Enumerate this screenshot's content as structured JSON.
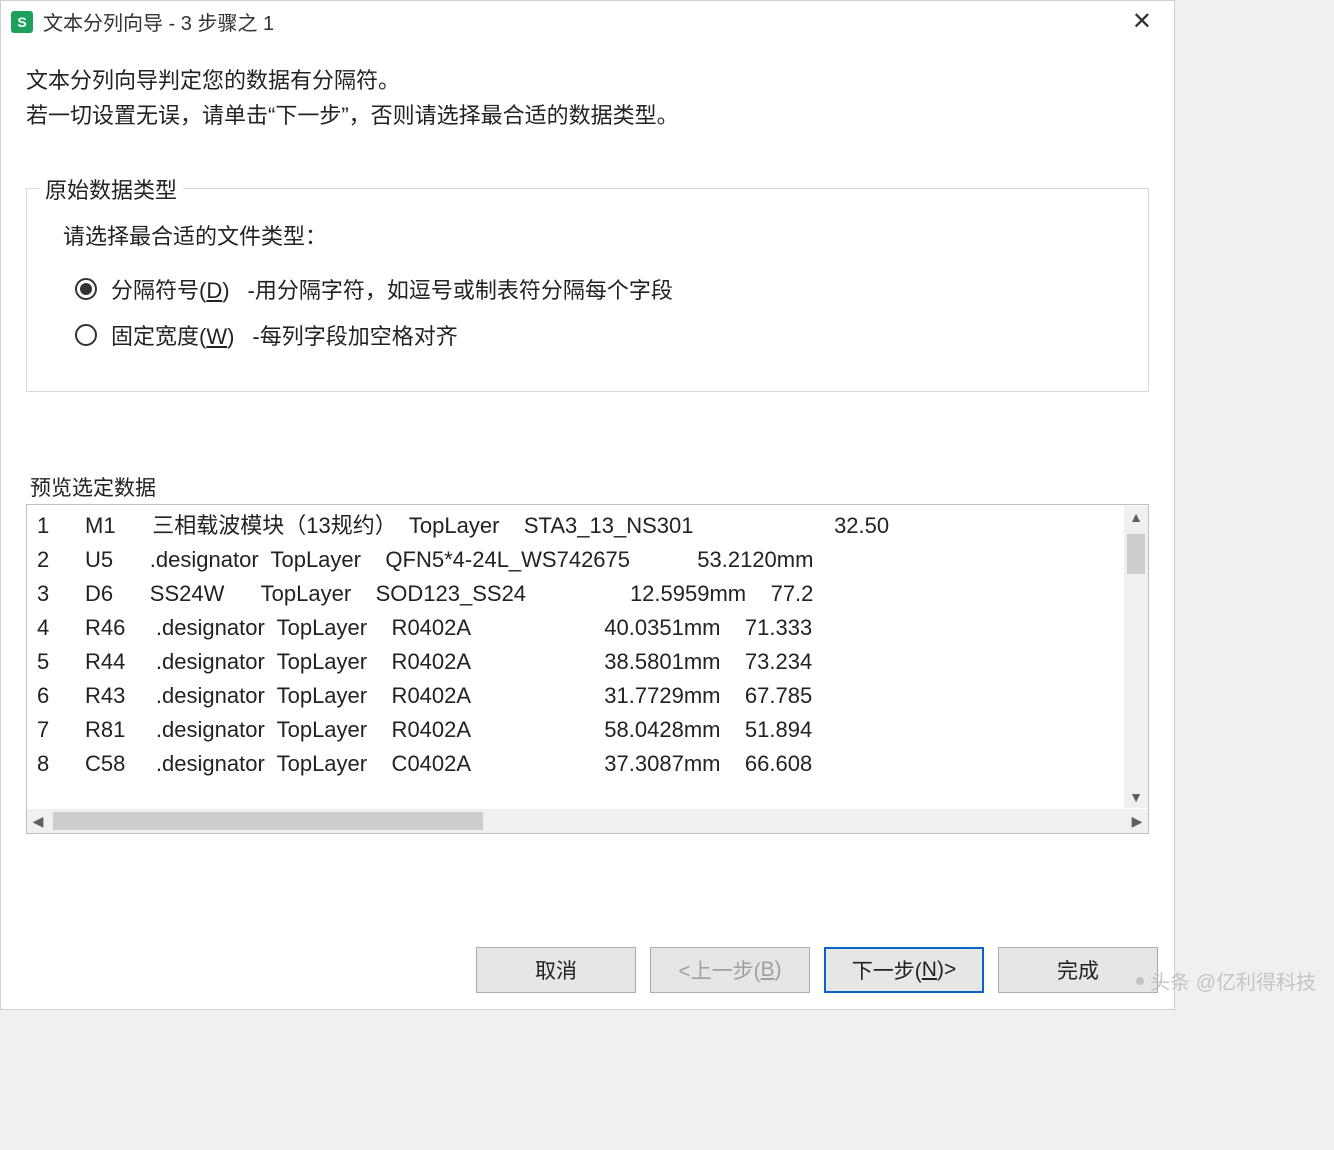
{
  "titlebar": {
    "app_icon_letter": "S",
    "title": "文本分列向导 - 3 步骤之 1"
  },
  "intro": {
    "line1": "文本分列向导判定您的数据有分隔符。",
    "line2": "若一切设置无误，请单击“下一步”，否则请选择最合适的数据类型。"
  },
  "datatype": {
    "legend": "原始数据类型",
    "instruction": "请选择最合适的文件类型：",
    "options": [
      {
        "label_pre": "分隔符号(",
        "label_key": "D",
        "label_post": ")",
        "desc": "-用分隔字符，如逗号或制表符分隔每个字段",
        "checked": true
      },
      {
        "label_pre": "固定宽度(",
        "label_key": "W",
        "label_post": ")",
        "desc": "-每列字段加空格对齐",
        "checked": false
      }
    ]
  },
  "preview": {
    "title": "预览选定数据",
    "rows": [
      {
        "n": "1",
        "text": "M1      三相载波模块（13规约）  TopLayer    STA3_13_NS301                       32.50"
      },
      {
        "n": "2",
        "text": "U5      .designator  TopLayer    QFN5*4-24L_WS742675           53.2120mm"
      },
      {
        "n": "3",
        "text": "D6      SS24W      TopLayer    SOD123_SS24                 12.5959mm    77.2"
      },
      {
        "n": "4",
        "text": "R46     .designator  TopLayer    R0402A                      40.0351mm    71.333"
      },
      {
        "n": "5",
        "text": "R44     .designator  TopLayer    R0402A                      38.5801mm    73.234"
      },
      {
        "n": "6",
        "text": "R43     .designator  TopLayer    R0402A                      31.7729mm    67.785"
      },
      {
        "n": "7",
        "text": "R81     .designator  TopLayer    R0402A                      58.0428mm    51.894"
      },
      {
        "n": "8",
        "text": "C58     .designator  TopLayer    C0402A                      37.3087mm    66.608"
      }
    ]
  },
  "buttons": {
    "cancel": "取消",
    "back_pre": "<上一步(",
    "back_key": "B",
    "back_post": ")",
    "next_pre": "下一步(",
    "next_key": "N",
    "next_post": ")>",
    "finish": "完成"
  },
  "watermark": "头条 @亿利得科技"
}
